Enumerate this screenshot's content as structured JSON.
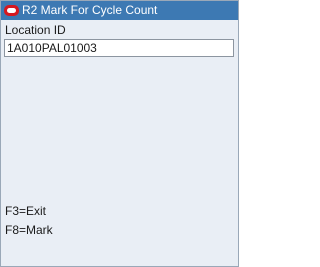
{
  "window": {
    "title": "R2 Mark For Cycle Count",
    "logo_icon": "oracle-logo-icon"
  },
  "form": {
    "location_label": "Location ID",
    "location_value": "1A010PAL01003"
  },
  "keys": {
    "exit": "F3=Exit",
    "mark": "F8=Mark"
  },
  "colors": {
    "titlebar": "#3d79b3",
    "background": "#e9eef5",
    "logo": "#d7181f"
  }
}
